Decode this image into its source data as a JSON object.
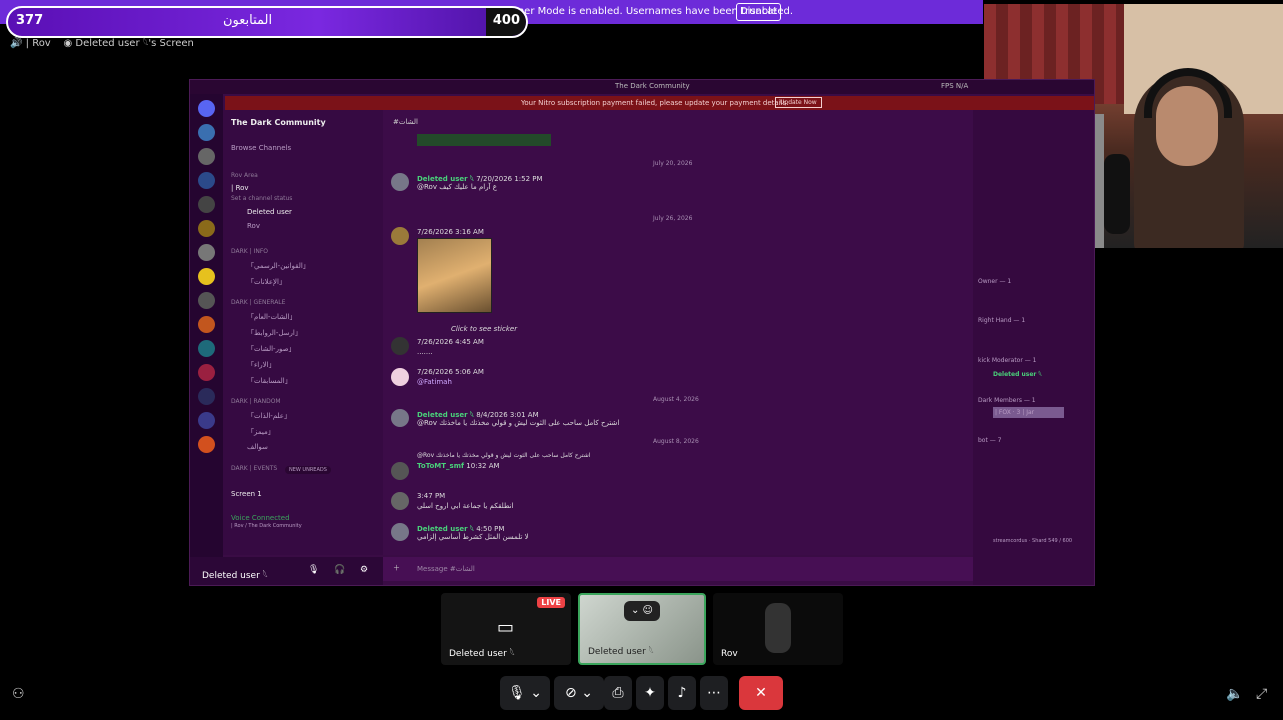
{
  "overlay": {
    "followers_left": "377",
    "followers_title": "المتابعون",
    "followers_right": "400"
  },
  "streamer_mode": {
    "text": "Streamer Mode is enabled. Usernames have been truncated.",
    "button": "Disable"
  },
  "breadcrumb": {
    "channel": "| Rov",
    "screen": "Deleted user 𓆩's Screen"
  },
  "share": {
    "window_title": "The Dark Community",
    "fps_label": "FPS  N/A",
    "nitro_text": "Your Nitro subscription payment failed, please update your payment details.",
    "nitro_button": "Update Now",
    "server_name": "The Dark Community",
    "browse": "Browse Channels",
    "channels": [
      {
        "label": "Rov Area",
        "cat": true
      },
      {
        "label": "| Rov",
        "cat": false
      },
      {
        "label": "Set a channel status",
        "cat": false
      },
      {
        "label": "Deleted user",
        "cat": false
      },
      {
        "label": "Rov",
        "cat": false
      },
      {
        "label": "DARK | INFO",
        "cat": true
      },
      {
        "label": "「القوانين-الرسمي」",
        "cat": false
      },
      {
        "label": "「الإعلانات」",
        "cat": false
      },
      {
        "label": "DARK | GENERALE",
        "cat": true
      },
      {
        "label": "「الشات-العام」",
        "cat": false
      },
      {
        "label": "「ارسل-الروابط」",
        "cat": false
      },
      {
        "label": "「صور-الشات」",
        "cat": false
      },
      {
        "label": "「الاراء」",
        "cat": false
      },
      {
        "label": "「المسابقات」",
        "cat": false
      },
      {
        "label": "DARK | RANDOM",
        "cat": true
      },
      {
        "label": "「علم-الذات」",
        "cat": false
      },
      {
        "label": "「ميمز」",
        "cat": false
      },
      {
        "label": "سوالف",
        "cat": false
      },
      {
        "label": "DARK | EVENTS",
        "cat": true
      }
    ],
    "new_unreads": "NEW UNREADS",
    "screen_label": "Screen 1",
    "voice_connected": "Voice Connected",
    "voice_sub": "| Rov / The Dark Community",
    "user_panel": "Deleted user 𓆩",
    "chat_channel": "#الشات",
    "dates": [
      "July 20, 2026",
      "July 26, 2026",
      "August 4, 2026",
      "August 8, 2026"
    ],
    "messages": [
      {
        "name": "Deleted user 𓆩",
        "time": "7/20/2026 1:52 PM",
        "text": "@Rov ع آرام ما عليك كيف"
      },
      {
        "name": "",
        "time": "7/26/2026 3:16 AM",
        "text": ""
      },
      {
        "name": "",
        "time": "",
        "text": "Click to see sticker"
      },
      {
        "name": "",
        "time": "7/26/2026 4:45 AM",
        "text": "......."
      },
      {
        "name": "",
        "time": "7/26/2026 5:06 AM",
        "text": "@Fatimah"
      },
      {
        "name": "Deleted user 𓆩",
        "time": "8/4/2026 3:01 AM",
        "text": "@Rov اشترح كامل ساحب على الثوت ليش و قولي مخذتك يا ماخذتك"
      },
      {
        "name": "ToToMT_smf",
        "time": "10:32 AM",
        "text": "@Rov اشترح كامل ساحب على الثوت ليش و قولي مخذتك يا ماخذتك"
      },
      {
        "name": "",
        "time": "3:47 PM",
        "text": "انطلقكم يا جماعة ابي اروح اسلي"
      },
      {
        "name": "Deleted user 𓆩",
        "time": "4:50 PM",
        "text": "لا تلمسن المثل كشرط أساسي إلزامي"
      }
    ],
    "input_placeholder": "Message #الشات",
    "members": [
      {
        "label": "Owner — 1"
      },
      {
        "label": "Right Hand — 1"
      },
      {
        "label": "kick Moderator — 1"
      },
      {
        "label": "Deleted user 𓆩"
      },
      {
        "label": "Dark Members — 1"
      },
      {
        "label": "| FOX · 3 | Jar"
      },
      {
        "label": "bot — 7"
      },
      {
        "label": "streamcordus · Shard 549 / 600"
      }
    ]
  },
  "tiles": [
    {
      "label": "Deleted user 𓆩",
      "live": "LIVE"
    },
    {
      "label": "Deleted user 𓆩"
    },
    {
      "label": "Rov"
    }
  ],
  "controls": {
    "mic": "mic-icon",
    "camera": "camera-off-icon",
    "share": "screen-share-icon",
    "activities": "activities-icon",
    "soundboard": "soundboard-icon",
    "more": "more-icon",
    "hangup": "hangup-icon"
  }
}
